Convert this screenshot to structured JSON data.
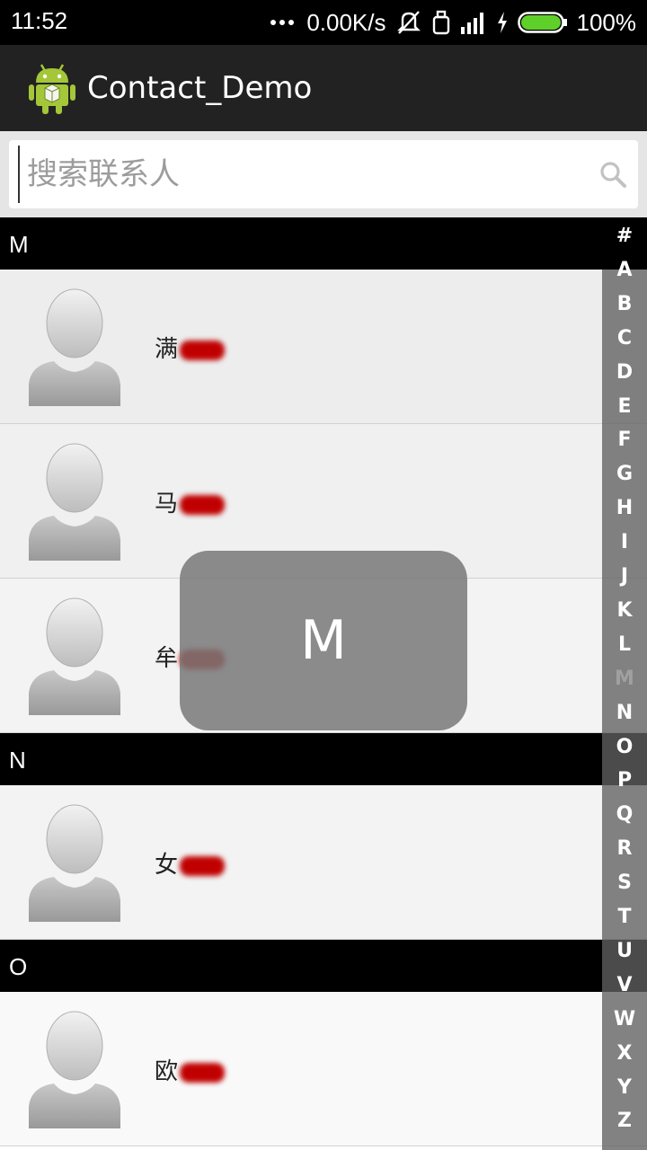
{
  "status_bar": {
    "time": "11:52",
    "speed": "0.00K/s",
    "battery": "100%",
    "icons": [
      "more-dots-icon",
      "mute-icon",
      "alarm-icon",
      "signal-icon",
      "charging-icon",
      "battery-icon"
    ]
  },
  "action_bar": {
    "title": "Contact_Demo",
    "icon": "android-icon"
  },
  "search": {
    "placeholder": "搜索联系人",
    "value": ""
  },
  "sections": [
    {
      "letter": "M",
      "contacts": [
        {
          "name": "满"
        },
        {
          "name": "马"
        },
        {
          "name": "牟"
        }
      ]
    },
    {
      "letter": "N",
      "contacts": [
        {
          "name": "女"
        }
      ]
    },
    {
      "letter": "O",
      "contacts": [
        {
          "name": "欧"
        }
      ]
    }
  ],
  "index_bar": {
    "letters": [
      "#",
      "A",
      "B",
      "C",
      "D",
      "E",
      "F",
      "G",
      "H",
      "I",
      "J",
      "K",
      "L",
      "M",
      "N",
      "O",
      "P",
      "Q",
      "R",
      "S",
      "T",
      "U",
      "V",
      "W",
      "X",
      "Y",
      "Z"
    ],
    "active": "M"
  },
  "overlay": {
    "letter": "M"
  },
  "colors": {
    "accent_battery": "#5fcf2a",
    "redaction": "#c00000"
  }
}
